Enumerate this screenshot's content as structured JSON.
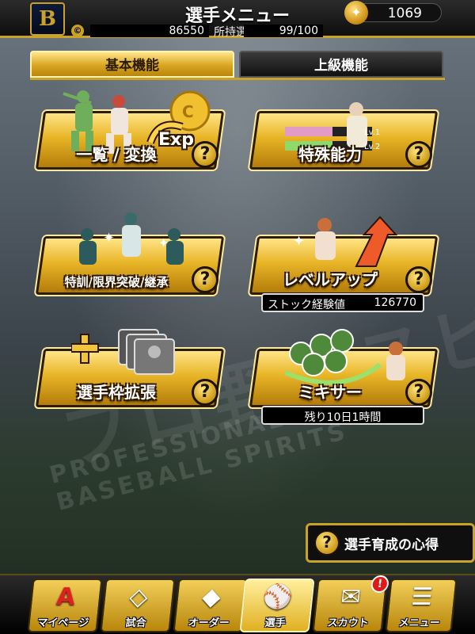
{
  "header": {
    "team_logo": "B",
    "title": "選手メニュー",
    "coins": "1069",
    "money_icon": "©",
    "money": "86550",
    "owned_label": "所持選手",
    "owned": "99/100"
  },
  "tabs": [
    {
      "label": "基本機能",
      "active": true
    },
    {
      "label": "上級機能",
      "active": false
    }
  ],
  "cards": {
    "list": {
      "label": "一覧 / 変換",
      "exp": "Exp"
    },
    "special": {
      "label": "特殊能力",
      "lv1": "Lv.1",
      "lv2": "Lv.2"
    },
    "training": {
      "label": "特訓/限界突破/継承"
    },
    "levelup": {
      "label": "レベルアップ",
      "sub_label": "ストック経験値",
      "sub_value": "126770"
    },
    "expand": {
      "label": "選手枠拡張"
    },
    "mixer": {
      "label": "ミキサー",
      "sub_text": "残り10日1時間"
    }
  },
  "watermark": {
    "logo_text": "プロ野球スピリッツ",
    "sub_text": "PROFESSIONAL BASEBALL SPIRITS"
  },
  "guide_button": {
    "icon": "?",
    "label": "選手育成の心得"
  },
  "help_icon": "?",
  "bottom_nav": [
    {
      "label": "マイページ",
      "icon": "A"
    },
    {
      "label": "試合",
      "icon": "◇"
    },
    {
      "label": "オーダー",
      "icon": "◆"
    },
    {
      "label": "選手",
      "icon": "⚾",
      "active": true
    },
    {
      "label": "スカウト",
      "icon": "✉",
      "badge": "!"
    },
    {
      "label": "メニュー",
      "icon": "☰"
    }
  ],
  "colors": {
    "accent": "#c9a227",
    "badge": "#e01818"
  }
}
